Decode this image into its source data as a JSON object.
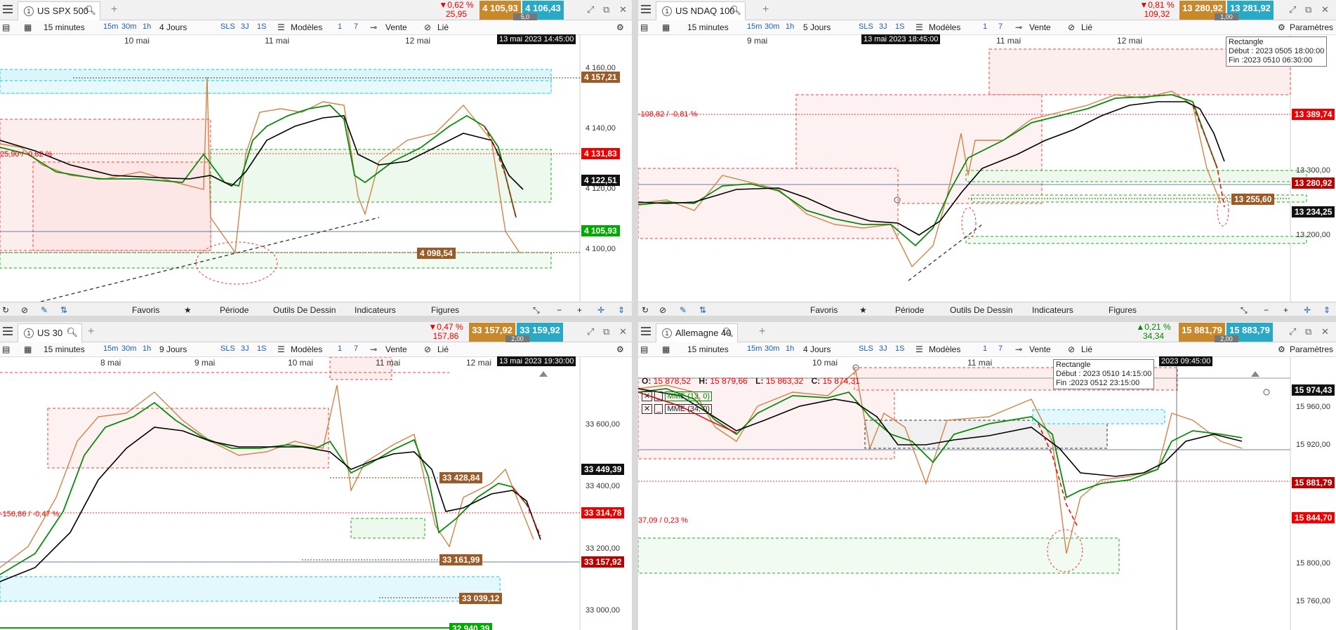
{
  "colors": {
    "bid": "#c8892d",
    "ask": "#2aa9c4",
    "up": "#00aa00",
    "down": "#e00000",
    "dark": "#111111",
    "brown": "#9a5b28"
  },
  "toolbar": {
    "interval": "15 minutes",
    "tf1": "15m",
    "tf2": "30m",
    "tf3": "1h",
    "sls": "SLS",
    "d3": "3J",
    "s1": "1S",
    "models": "Modèles",
    "n1": "1",
    "n7": "7",
    "sell": "Vente",
    "linked": "Lié",
    "settings": "Paramètres"
  },
  "bottombar": {
    "favs": "Favoris",
    "period": "Période",
    "draw": "Outils De Dessin",
    "indic": "Indicateurs",
    "figs": "Figures"
  },
  "panes": [
    {
      "symbol": "US SPX 500",
      "days": "4 Jours",
      "change_pct": "▼0,62 %",
      "change_abs": "25,95",
      "bid": "4 105,93",
      "ask": "4 106,43",
      "spread": "5,0",
      "dates": [
        "10 mai",
        "11 mai",
        "12 mai"
      ],
      "cursor": "13 mai 2023 14:45:00",
      "prices": [
        "4 160,00",
        "4 140,00",
        "4 120,00",
        "4 100,00"
      ],
      "tags": [
        "4 157,21",
        "4 131,83",
        "4 122,51",
        "4 105,93",
        "4 098,54"
      ],
      "note": "25,90 / -0,62 %"
    },
    {
      "symbol": "US NDAQ 100",
      "days": "5 Jours",
      "change_pct": "▼0,81 %",
      "change_abs": "109,32",
      "bid": "13 280,92",
      "ask": "13 281,92",
      "spread": "1,00",
      "dates": [
        "9 mai",
        "11 mai",
        "12 mai"
      ],
      "cursor": "13 mai 2023 18:45:00",
      "prices": [
        "13 300,00",
        "13 200,00"
      ],
      "tags": [
        "13 389,74",
        "13 280,92",
        "13 255,60",
        "13 234,25"
      ],
      "note": "-108,82 / -0,81 %",
      "tooltip": [
        "Rectangle",
        "Début : 2023 0505 18:00:00",
        "Fin :2023 0510 06:30:00"
      ]
    },
    {
      "symbol": "US 30",
      "days": "9 Jours",
      "change_pct": "▼0,47 %",
      "change_abs": "157,86",
      "bid": "33 157,92",
      "ask": "33 159,92",
      "spread": "2,00",
      "dates": [
        "8 mai",
        "9 mai",
        "10 mai",
        "11 mai",
        "12 mai"
      ],
      "cursor": "13 mai 2023 19:30:00",
      "prices": [
        "33 600,00",
        "33 400,00",
        "33 200,00",
        "33 000,00"
      ],
      "tags": [
        "33 449,39",
        "33 428,84",
        "33 314,78",
        "33 161,99",
        "33 157,92",
        "33 039,12",
        "32 940,39"
      ],
      "note": "-156,86 / -0,47 %"
    },
    {
      "symbol": "Allemagne 40",
      "days": "4 Jours",
      "change_pct": "▲0,21 %",
      "change_abs": "34,34",
      "bid": "15 881,79",
      "ask": "15 883,79",
      "spread": "2,00",
      "dates": [
        "10 mai",
        "11 mai"
      ],
      "cursor": "2023 09:45:00",
      "prices": [
        "15 960,00",
        "15 920,00",
        "15 800,00",
        "15 760,00"
      ],
      "tags": [
        "15 974,43",
        "15 881,79",
        "15 844,70"
      ],
      "note": "37,09 / 0,23 %",
      "ohlc": {
        "o": "15 878,52",
        "h": "15 879,66",
        "l": "15 863,32",
        "c": "15 874,31"
      },
      "mme1": "MME (13, 0)",
      "mme2": "MME (34, 0)",
      "tooltip": [
        "Rectangle",
        "Début : 2023 0510 14:15:00",
        "Fin :2023 0512 23:15:00"
      ]
    }
  ]
}
